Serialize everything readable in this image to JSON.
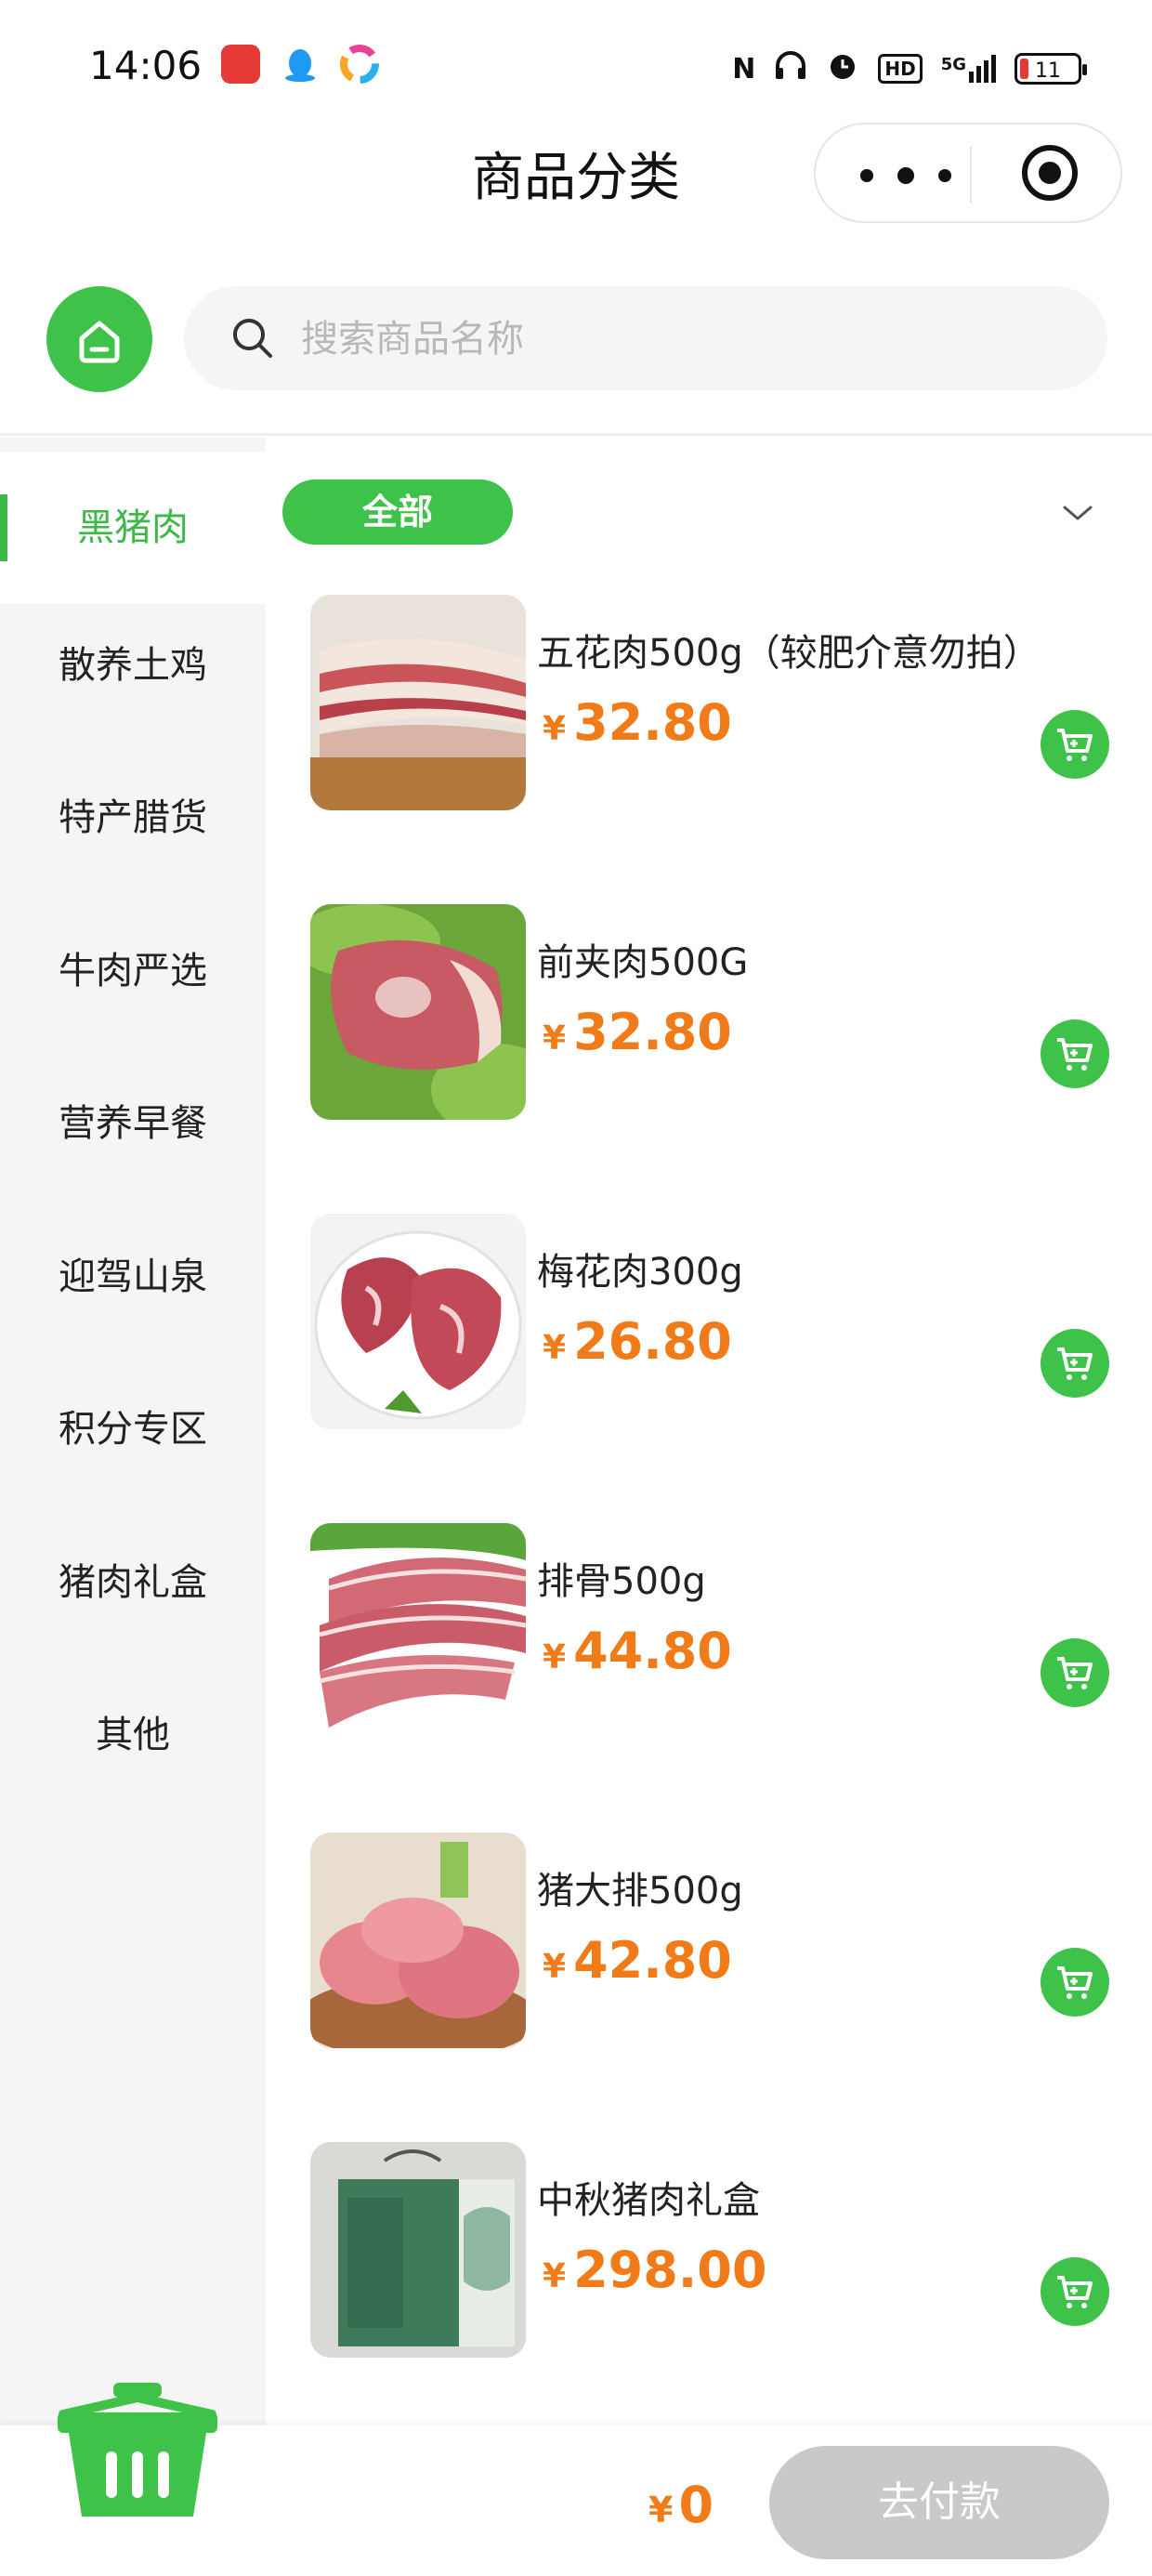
{
  "status_bar": {
    "time": "14:06",
    "battery": "11",
    "network": "5G",
    "hd": "HD"
  },
  "header": {
    "title": "商品分类"
  },
  "search": {
    "placeholder": "搜索商品名称"
  },
  "sidebar": {
    "items": [
      {
        "label": "黑猪肉",
        "active": true
      },
      {
        "label": "散养土鸡"
      },
      {
        "label": "特产腊货"
      },
      {
        "label": "牛肉严选"
      },
      {
        "label": "营养早餐"
      },
      {
        "label": "迎驾山泉"
      },
      {
        "label": "积分专区"
      },
      {
        "label": "猪肉礼盒"
      },
      {
        "label": "其他"
      }
    ]
  },
  "subcategory": {
    "active_label": "全部"
  },
  "products": [
    {
      "name": "五花肉500g（较肥介意勿拍）",
      "currency": "¥",
      "price": "32.80"
    },
    {
      "name": "前夹肉500G",
      "currency": "¥",
      "price": "32.80"
    },
    {
      "name": "梅花肉300g",
      "currency": "¥",
      "price": "26.80"
    },
    {
      "name": "排骨500g",
      "currency": "¥",
      "price": "44.80"
    },
    {
      "name": "猪大排500g",
      "currency": "¥",
      "price": "42.80"
    },
    {
      "name": "中秋猪肉礼盒",
      "currency": "¥",
      "price": "298.00"
    }
  ],
  "checkout": {
    "currency": "¥",
    "total": "0",
    "pay_label": "去付款"
  },
  "colors": {
    "accent_green": "#3fc24a",
    "price_orange": "#f07b18",
    "disabled_gray": "#c9c9c9"
  }
}
